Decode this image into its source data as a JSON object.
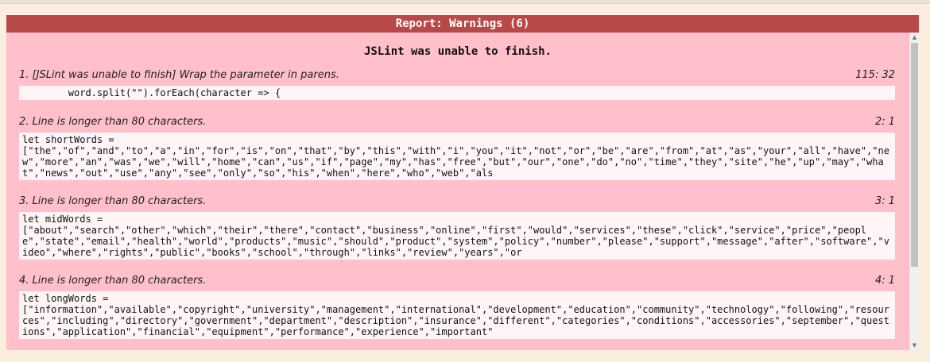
{
  "report": {
    "header": "Report: Warnings (6)",
    "title": "JSLint was unable to finish."
  },
  "warnings": [
    {
      "message": "1. [JSLint was unable to finish] Wrap the parameter in parens.",
      "position": "115: 32",
      "code": "        word.split(\"\").forEach(character => {"
    },
    {
      "message": "2. Line is longer than 80 characters.",
      "position": "2: 1",
      "code": "let shortWords =\n[\"the\",\"of\",\"and\",\"to\",\"a\",\"in\",\"for\",\"is\",\"on\",\"that\",\"by\",\"this\",\"with\",\"i\",\"you\",\"it\",\"not\",\"or\",\"be\",\"are\",\"from\",\"at\",\"as\",\"your\",\"all\",\"have\",\"new\",\"more\",\"an\",\"was\",\"we\",\"will\",\"home\",\"can\",\"us\",\"if\",\"page\",\"my\",\"has\",\"free\",\"but\",\"our\",\"one\",\"do\",\"no\",\"time\",\"they\",\"site\",\"he\",\"up\",\"may\",\"what\",\"news\",\"out\",\"use\",\"any\",\"see\",\"only\",\"so\",\"his\",\"when\",\"here\",\"who\",\"web\",\"als"
    },
    {
      "message": "3. Line is longer than 80 characters.",
      "position": "3: 1",
      "code": "let midWords =\n[\"about\",\"search\",\"other\",\"which\",\"their\",\"there\",\"contact\",\"business\",\"online\",\"first\",\"would\",\"services\",\"these\",\"click\",\"service\",\"price\",\"people\",\"state\",\"email\",\"health\",\"world\",\"products\",\"music\",\"should\",\"product\",\"system\",\"policy\",\"number\",\"please\",\"support\",\"message\",\"after\",\"software\",\"video\",\"where\",\"rights\",\"public\",\"books\",\"school\",\"through\",\"links\",\"review\",\"years\",\"or"
    },
    {
      "message": "4. Line is longer than 80 characters.",
      "position": "4: 1",
      "code": "let longWords =\n[\"information\",\"available\",\"copyright\",\"university\",\"management\",\"international\",\"development\",\"education\",\"community\",\"technology\",\"following\",\"resources\",\"including\",\"directory\",\"government\",\"department\",\"description\",\"insurance\",\"different\",\"categories\",\"conditions\",\"accessories\",\"september\",\"questions\",\"application\",\"financial\",\"equipment\",\"performance\",\"experience\",\"important\""
    }
  ],
  "colors": {
    "header_bg": "#b94848",
    "panel_bg": "#ffc0cb",
    "code_bg": "#fff5f7"
  }
}
